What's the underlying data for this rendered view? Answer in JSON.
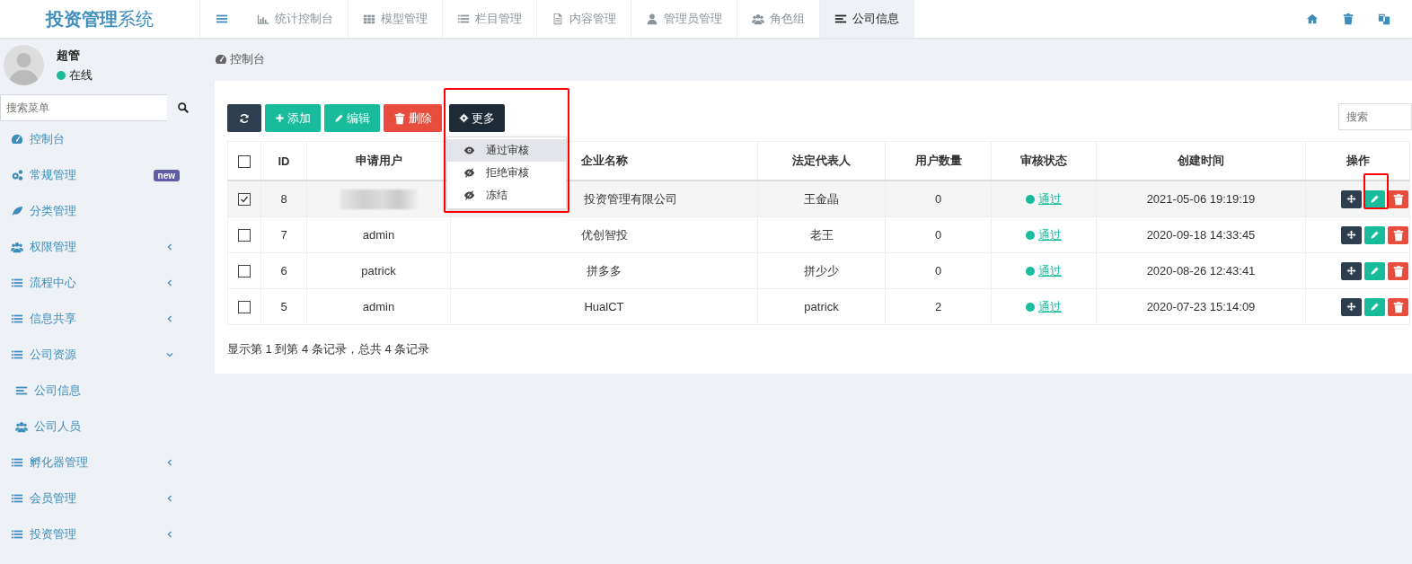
{
  "logo": {
    "bold": "投资管理",
    "light": "系统"
  },
  "tabs": [
    {
      "label": "统计控制台",
      "selected": false
    },
    {
      "label": "模型管理",
      "selected": false
    },
    {
      "label": "栏目管理",
      "selected": false
    },
    {
      "label": "内容管理",
      "selected": false
    },
    {
      "label": "管理员管理",
      "selected": false
    },
    {
      "label": "角色组",
      "selected": false
    },
    {
      "label": "公司信息",
      "selected": true
    }
  ],
  "user": {
    "name": "超管",
    "status": "在线",
    "online": true
  },
  "menu_search": {
    "placeholder": "搜索菜单"
  },
  "menu": [
    {
      "label": "控制台"
    },
    {
      "label": "常规管理",
      "badge": "new"
    },
    {
      "label": "分类管理"
    },
    {
      "label": "权限管理",
      "expanded": false,
      "has_children": true
    },
    {
      "label": "流程中心",
      "expanded": false,
      "has_children": true
    },
    {
      "label": "信息共享",
      "expanded": false,
      "has_children": true
    },
    {
      "label": "公司资源",
      "expanded": true,
      "has_children": true,
      "children": [
        {
          "label": "公司信息"
        },
        {
          "label": "公司人员"
        }
      ]
    },
    {
      "label": "孵化器管理",
      "expanded": false,
      "has_children": true
    },
    {
      "label": "会员管理",
      "expanded": false,
      "has_children": true
    },
    {
      "label": "投资管理",
      "expanded": false,
      "has_children": true
    }
  ],
  "breadcrumb": "控制台",
  "toolbar": [
    {
      "kind": "refresh"
    },
    {
      "kind": "add",
      "label": "添加"
    },
    {
      "kind": "edit",
      "label": "编辑"
    },
    {
      "kind": "delete",
      "label": "删除"
    },
    {
      "kind": "more",
      "label": "更多"
    }
  ],
  "more_menu": [
    {
      "label": "通过审核",
      "selected": true
    },
    {
      "label": "拒绝审核",
      "selected": false
    },
    {
      "label": "冻结",
      "selected": false
    }
  ],
  "table_search": {
    "placeholder": "搜索"
  },
  "table": {
    "select_all": false,
    "columns": [
      "ID",
      "申请用户",
      "企业名称",
      "法定代表人",
      "用户数量",
      "审核状态",
      "创建时间",
      "操作"
    ],
    "rows": [
      {
        "checked": true,
        "id": "8",
        "user_redacted": true,
        "company": "投资管理有限公司",
        "legal_rep": "王金晶",
        "user_count": "0",
        "status": "通过",
        "created": "2021-05-06 19:19:19"
      },
      {
        "checked": false,
        "id": "7",
        "user": "admin",
        "user_redacted": false,
        "company": "优创智投",
        "legal_rep": "老王",
        "user_count": "0",
        "status": "通过",
        "created": "2020-09-18 14:33:45"
      },
      {
        "checked": false,
        "id": "6",
        "user": "patrick",
        "user_redacted": false,
        "company": "拼多多",
        "legal_rep": "拼少少",
        "user_count": "0",
        "status": "通过",
        "created": "2020-08-26 12:43:41"
      },
      {
        "checked": false,
        "id": "5",
        "user": "admin",
        "user_redacted": false,
        "company": "HualCT",
        "legal_rep": "patrick",
        "user_count": "2",
        "status": "通过",
        "created": "2020-07-23 15:14:09"
      }
    ]
  },
  "pagination_info": "显示第 1 到第 4 条记录，总共 4 条记录"
}
